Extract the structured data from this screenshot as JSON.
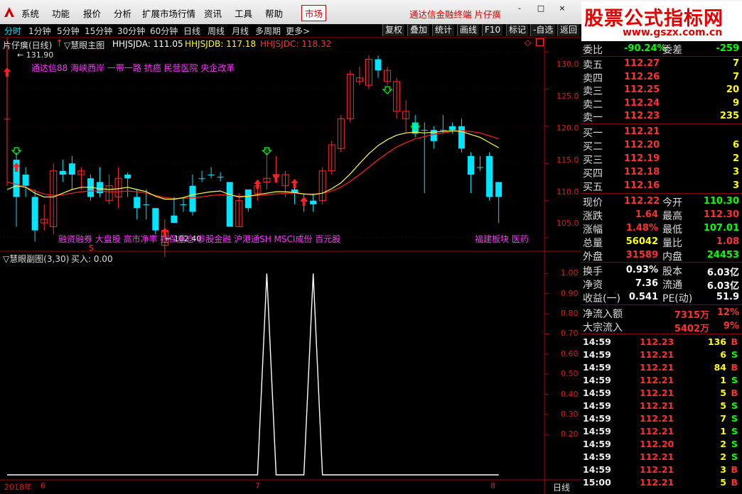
{
  "menu": {
    "items": [
      "系统",
      "功能",
      "报价",
      "分析",
      "扩展市场行情",
      "资讯",
      "工具",
      "帮助"
    ],
    "market": "市场",
    "title": "通达信金融终端  片仔癀",
    "window_buttons": [
      "-",
      "□",
      "×"
    ]
  },
  "watermark": {
    "title": "股票公式指标网",
    "url": "www.gszx.com.cn"
  },
  "periods": [
    "分时",
    "1分钟",
    "5分钟",
    "15分钟",
    "30分钟",
    "60分钟",
    "日线",
    "周线",
    "月线",
    "多周期",
    "更多>"
  ],
  "active_period": "分时",
  "tools": [
    "复权",
    "叠加",
    "统计",
    "画线",
    "F10",
    "标记",
    "-自选",
    "返回"
  ],
  "main_chart": {
    "stock": "片仔癀(日线)",
    "indicator": "慧眼主图",
    "hhjsjda_label": "HHJSJDA: 111.05",
    "hhjsjdb_label": "HHJSJDB: 117.18",
    "hhjsjdc_label": "HHJSJDC: 118.32",
    "high_marker": "131.90",
    "low_marker": "102.40",
    "anno_top": "通达信88 海峡西岸 一带一路 抗癌 民营医院 央企改革",
    "anno_bottom": "融资融券 大盘股 高市净率 社保重仓 参股金融 沪港通SH MSCI成份 百元股",
    "anno_right": "福建板块 医药",
    "s_mark": "S",
    "y_ticks": [
      "130.0",
      "125.0",
      "120.0",
      "115.0",
      "110.0",
      "105.0"
    ]
  },
  "chart_data": [
    {
      "type": "candlestick",
      "ylim": [
        103.2,
        132
      ],
      "y_ticks": [
        105,
        110,
        115,
        120,
        125,
        130
      ],
      "high_label": 131.9,
      "low_label": 102.4,
      "candles": [
        [
          121,
          121,
          131.9,
          112,
          "r"
        ],
        [
          110.5,
          115.5,
          116.5,
          106.5,
          "c"
        ],
        [
          113.5,
          112.0,
          114.5,
          110.5,
          "c"
        ],
        [
          110.5,
          106.0,
          111.5,
          104.5,
          "c"
        ],
        [
          107.0,
          107.5,
          109.5,
          106.0,
          "r"
        ],
        [
          106.5,
          114.0,
          115.0,
          105.5,
          "r"
        ],
        [
          114.0,
          113.5,
          115.5,
          112.5,
          "c"
        ],
        [
          115.0,
          113.5,
          116.0,
          111.5,
          "c"
        ],
        [
          113.5,
          114.0,
          114.5,
          111.5,
          "r"
        ],
        [
          113.0,
          110.5,
          113.5,
          110.0,
          "c"
        ],
        [
          112.5,
          111.0,
          114.5,
          110.5,
          "c"
        ],
        [
          110.0,
          112.0,
          113.5,
          109.5,
          "r"
        ],
        [
          110.5,
          113.0,
          114.5,
          109.0,
          "r"
        ],
        [
          113.5,
          113.0,
          113.8,
          110.5,
          "c"
        ],
        [
          110.5,
          109.0,
          111.5,
          107.5,
          "c"
        ],
        [
          109.5,
          109.5,
          111.5,
          107.5,
          "c"
        ],
        [
          109.0,
          106.0,
          109.0,
          105.5,
          "c"
        ],
        [
          104.0,
          106.0,
          107.5,
          102.4,
          "r"
        ],
        [
          107.0,
          108.0,
          110.5,
          107.0,
          "c"
        ],
        [
          109.5,
          109.5,
          110.5,
          108.5,
          "c"
        ],
        [
          108.5,
          112.0,
          113.5,
          108.0,
          "c"
        ],
        [
          113.0,
          113.0,
          114.0,
          112.5,
          "c"
        ],
        [
          113.5,
          113.5,
          114.5,
          113.0,
          "c"
        ],
        [
          113.2,
          113.2,
          113.8,
          112.6,
          "c"
        ],
        [
          112.5,
          106.5,
          112.5,
          106.5,
          "c"
        ],
        [
          106.5,
          110.0,
          111.0,
          106.5,
          "r"
        ],
        [
          109.0,
          111.5,
          111.5,
          108.5,
          "c"
        ],
        [
          111.0,
          112.0,
          112.5,
          110.0,
          "r"
        ],
        [
          112.5,
          113.0,
          117.0,
          111.5,
          "r"
        ],
        [
          113.5,
          113.5,
          116.0,
          113.0,
          "r"
        ],
        [
          113.5,
          112.0,
          114.0,
          110.5,
          "r"
        ],
        [
          111.5,
          111.0,
          112.0,
          109.5,
          "c"
        ],
        [
          110.0,
          110.0,
          111.0,
          108.5,
          "c"
        ],
        [
          109.5,
          110.0,
          111.0,
          108.5,
          "c"
        ],
        [
          110.0,
          114.0,
          114.5,
          109.5,
          "r"
        ],
        [
          114.0,
          117.5,
          118.0,
          113.5,
          "r"
        ],
        [
          117.0,
          121.0,
          121.5,
          116.5,
          "r"
        ],
        [
          121.0,
          127.0,
          127.5,
          120.5,
          "r"
        ],
        [
          126.0,
          126.5,
          128.0,
          125.5,
          "r"
        ],
        [
          125.5,
          129.0,
          129.5,
          125.0,
          "r"
        ],
        [
          129.0,
          127.5,
          129.5,
          126.5,
          "c"
        ],
        [
          127.5,
          126.0,
          128.0,
          125.5,
          "r"
        ],
        [
          126.0,
          122.0,
          126.5,
          121.0,
          "r"
        ],
        [
          122.0,
          121.0,
          123.5,
          119.0,
          "r"
        ],
        [
          120.5,
          119.0,
          121.5,
          118.5,
          "c"
        ],
        [
          119.5,
          119.5,
          120.5,
          111.0,
          "c"
        ],
        [
          118.0,
          119.5,
          120.0,
          117.0,
          "c"
        ],
        [
          119.5,
          119.5,
          121.5,
          119.0,
          "c"
        ],
        [
          120.0,
          119.5,
          120.5,
          119.0,
          "c"
        ],
        [
          120.0,
          117.0,
          121.0,
          116.5,
          "c"
        ],
        [
          116.0,
          113.5,
          116.5,
          111.0,
          "c"
        ],
        [
          114.5,
          114.5,
          116.0,
          114.0,
          "c"
        ],
        [
          116.0,
          110.5,
          116.5,
          110.0,
          "c"
        ],
        [
          110.5,
          112.5,
          112.5,
          107.0,
          "c"
        ]
      ],
      "ma_yellow": [
        111.5,
        112,
        111.8,
        111,
        110.5,
        110.5,
        111,
        111.5,
        111.8,
        111.8,
        111.6,
        111.5,
        111.6,
        111.8,
        111.5,
        111.2,
        110.6,
        110.2,
        110.2,
        110.4,
        110.8,
        111,
        111.2,
        111.3,
        110.8,
        110.5,
        110.6,
        110.8,
        111,
        111.2,
        111.2,
        111.1,
        110.9,
        110.8,
        111,
        111.6,
        112.4,
        113.6,
        115,
        116.3,
        117.4,
        118.2,
        118.8,
        119.1,
        119.2,
        119.1,
        119.2,
        119.3,
        119.4,
        119.3,
        118.9,
        118.5,
        117.8,
        117.1
      ],
      "ma_red": [
        112.5,
        112.2,
        111.8,
        111.3,
        110.9,
        110.7,
        110.8,
        111,
        111.2,
        111.3,
        111.3,
        111.2,
        111.2,
        111.3,
        111.2,
        111,
        110.7,
        110.4,
        110.3,
        110.3,
        110.4,
        110.5,
        110.7,
        110.8,
        110.7,
        110.6,
        110.6,
        110.7,
        110.8,
        110.9,
        111,
        111,
        110.9,
        110.9,
        111,
        111.3,
        111.8,
        112.6,
        113.5,
        114.5,
        115.5,
        116.4,
        117.2,
        117.8,
        118.3,
        118.6,
        118.9,
        119.1,
        119.3,
        119.4,
        119.3,
        119.1,
        118.7,
        118.3
      ]
    },
    {
      "type": "line",
      "title": "慧眼副图(3,30)",
      "legend": "买入: 0.00",
      "ylim": [
        0,
        1.04
      ],
      "y_ticks": [
        0.2,
        0.3,
        0.4,
        0.5,
        0.6,
        0.7,
        0.8,
        0.9,
        1.0
      ],
      "y_tick_labels": [
        "0.20",
        "0.30",
        "0.40",
        "0.50",
        "0.60",
        "0.70",
        "0.80",
        "0.90",
        "1.00"
      ],
      "x_labels": [
        "2018年",
        "6",
        "7",
        "8"
      ],
      "series": [
        {
          "values": [
            0,
            0,
            0,
            0,
            0,
            0,
            0,
            0,
            0,
            0,
            0,
            0,
            0,
            0,
            0,
            0,
            0,
            0,
            0,
            0,
            0,
            0,
            0,
            0,
            0,
            0,
            0,
            0,
            1,
            0,
            0,
            0,
            0,
            1,
            0,
            0,
            0,
            0,
            0,
            0,
            0,
            0,
            0,
            0,
            0,
            0,
            0,
            0,
            0,
            0,
            0,
            0,
            0,
            0
          ]
        }
      ]
    }
  ],
  "xaxis_right_label": "日线",
  "quotes": {
    "wb": {
      "label": "委比",
      "value": "-90.24%",
      "label2": "委差",
      "value2": "-259"
    },
    "asks": [
      {
        "label": "卖五",
        "price": "112.27",
        "vol": "7"
      },
      {
        "label": "卖四",
        "price": "112.26",
        "vol": "7"
      },
      {
        "label": "卖三",
        "price": "112.25",
        "vol": "20"
      },
      {
        "label": "卖二",
        "price": "112.24",
        "vol": "9"
      },
      {
        "label": "卖一",
        "price": "112.23",
        "vol": "235"
      }
    ],
    "bids": [
      {
        "label": "买一",
        "price": "112.21",
        "vol": ""
      },
      {
        "label": "买二",
        "price": "112.20",
        "vol": "6"
      },
      {
        "label": "买三",
        "price": "112.19",
        "vol": "2"
      },
      {
        "label": "买四",
        "price": "112.18",
        "vol": "3"
      },
      {
        "label": "买五",
        "price": "112.16",
        "vol": "3"
      }
    ],
    "stats": [
      {
        "l1": "现价",
        "v1": "112.22",
        "c1": "#ff3030",
        "l2": "今开",
        "v2": "110.30",
        "c2": "#00ff00"
      },
      {
        "l1": "涨跌",
        "v1": "1.64",
        "c1": "#ff3030",
        "l2": "最高",
        "v2": "112.30",
        "c2": "#ff3030"
      },
      {
        "l1": "涨幅",
        "v1": "1.48%",
        "c1": "#ff3030",
        "l2": "最低",
        "v2": "107.01",
        "c2": "#00ff00"
      },
      {
        "l1": "总量",
        "v1": "56042",
        "c1": "#ffff00",
        "l2": "量比",
        "v2": "1.08",
        "c2": "#ff3030"
      },
      {
        "l1": "外盘",
        "v1": "31589",
        "c1": "#ff3030",
        "l2": "内盘",
        "v2": "24453",
        "c2": "#00ff00"
      }
    ],
    "stats2": [
      {
        "l1": "换手",
        "v1": "0.93%",
        "l2": "股本",
        "v2": "6.03亿"
      },
      {
        "l1": "净资",
        "v1": "7.36",
        "l2": "流通",
        "v2": "6.03亿"
      },
      {
        "l1": "收益(一)",
        "v1": "0.541",
        "l2": "PE(动)",
        "v2": "51.9"
      }
    ],
    "flows": [
      {
        "label": "净流入额",
        "value": "7315万",
        "pct": "12%"
      },
      {
        "label": "大宗流入",
        "value": "5402万",
        "pct": "9%"
      }
    ]
  },
  "ticks": [
    {
      "time": "14:59",
      "price": "112.23",
      "vol": "136",
      "bs": "B"
    },
    {
      "time": "14:59",
      "price": "112.21",
      "vol": "6",
      "bs": "S"
    },
    {
      "time": "14:59",
      "price": "112.21",
      "vol": "84",
      "bs": "B"
    },
    {
      "time": "14:59",
      "price": "112.21",
      "vol": "1",
      "bs": "S"
    },
    {
      "time": "14:59",
      "price": "112.21",
      "vol": "5",
      "bs": "B"
    },
    {
      "time": "14:59",
      "price": "112.21",
      "vol": "5",
      "bs": "S"
    },
    {
      "time": "14:59",
      "price": "112.21",
      "vol": "7",
      "bs": "S"
    },
    {
      "time": "14:59",
      "price": "112.21",
      "vol": "1",
      "bs": "S"
    },
    {
      "time": "14:59",
      "price": "112.20",
      "vol": "2",
      "bs": "S"
    },
    {
      "time": "14:59",
      "price": "112.21",
      "vol": "2",
      "bs": "S"
    },
    {
      "time": "14:59",
      "price": "112.21",
      "vol": "3",
      "bs": "B"
    },
    {
      "time": "15:00",
      "price": "112.21",
      "vol": "5",
      "bs": "B"
    }
  ],
  "colors": {
    "up": "#ff2a2a",
    "down": "#00e5ff",
    "accent": "#e00000"
  }
}
